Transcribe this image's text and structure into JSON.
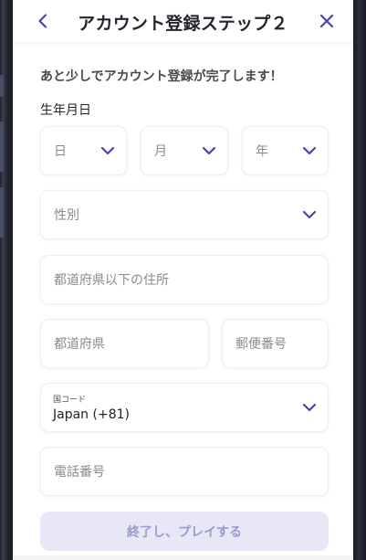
{
  "header": {
    "title": "アカウント登録ステップ２",
    "back_icon": "chevron-left-icon",
    "close_icon": "close-icon"
  },
  "form": {
    "subtitle": "あと少しでアカウント登録が完了します！",
    "dob_label": "生年月日",
    "day_placeholder": "日",
    "month_placeholder": "月",
    "year_placeholder": "年",
    "gender_placeholder": "性別",
    "address_placeholder": "都道府県以下の住所",
    "prefecture_placeholder": "都道府県",
    "postal_placeholder": "郵便番号",
    "country_code_label": "国コード",
    "country_code_value": "Japan (+81)",
    "phone_placeholder": "電話番号",
    "submit_label": "終了し、プレイする"
  },
  "colors": {
    "accent": "#4b45a8",
    "submit_bg": "#e8e7f7",
    "submit_text": "#9b98d0"
  }
}
